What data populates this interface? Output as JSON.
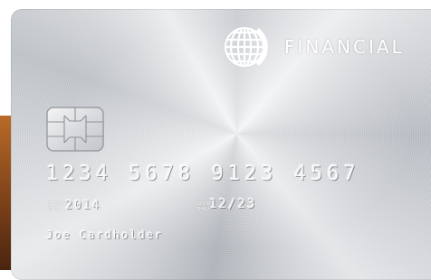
{
  "card": {
    "brand": "FINANCIAL",
    "logo_icon": "globe-icon",
    "chip_icon": "emv-chip-icon",
    "number": "1234 5678 9123 4567",
    "customer_since_label_line1": "CUSTOMER",
    "customer_since_label_line2": "SINCE",
    "customer_since": "2014",
    "good_thru_label_line1": "GOOD",
    "good_thru_label_line2": "THRU",
    "good_thru": "12/23",
    "cardholder": "Joe Cardholder"
  },
  "colors": {
    "card_silver": "#d8dbdf",
    "edge_bronze": "#9a5520",
    "emboss_text": "#f7f8fa"
  }
}
